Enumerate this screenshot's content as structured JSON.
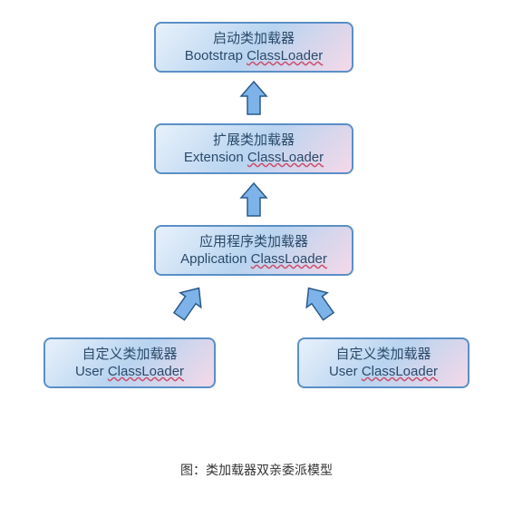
{
  "nodes": {
    "bootstrap": {
      "cn": "启动类加载器",
      "en_pre": "Bootstrap ",
      "en_u": "ClassLoader"
    },
    "extension": {
      "cn": "扩展类加载器",
      "en_pre": "Extension ",
      "en_u": "ClassLoader"
    },
    "application": {
      "cn": "应用程序类加载器",
      "en_pre": "Application ",
      "en_u": "ClassLoader"
    },
    "user_left": {
      "cn": "自定义类加载器",
      "en_pre": "User ",
      "en_u": "ClassLoader"
    },
    "user_right": {
      "cn": "自定义类加载器",
      "en_pre": "User ",
      "en_u": "ClassLoader"
    }
  },
  "caption": "图：类加载器双亲委派模型",
  "colors": {
    "border": "#5a8fc7",
    "arrow_fill": "#7db3e8",
    "arrow_stroke": "#2a5a8a"
  }
}
